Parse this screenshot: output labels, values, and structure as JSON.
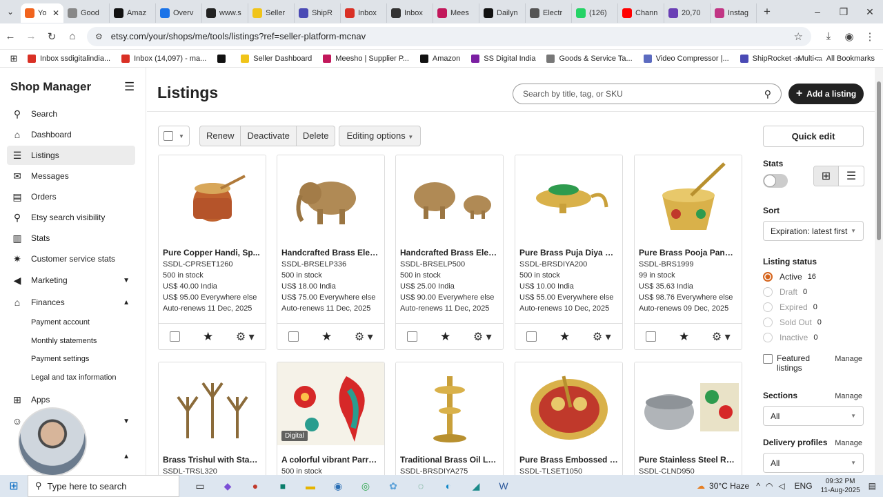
{
  "browser": {
    "tabs": [
      {
        "label": "Yo",
        "color": "#f1641e",
        "active": true
      },
      {
        "label": "Good",
        "color": "#888888"
      },
      {
        "label": "Amaz",
        "color": "#111111"
      },
      {
        "label": "Overv",
        "color": "#1a73e8"
      },
      {
        "label": "www.s",
        "color": "#222222"
      },
      {
        "label": "Seller",
        "color": "#f0c419"
      },
      {
        "label": "ShipR",
        "color": "#4a4ab5"
      },
      {
        "label": "Inbox",
        "color": "#d93025"
      },
      {
        "label": "Inbox",
        "color": "#333333"
      },
      {
        "label": "Mees",
        "color": "#c2185b"
      },
      {
        "label": "Dailyn",
        "color": "#111111"
      },
      {
        "label": "Electr",
        "color": "#555555"
      },
      {
        "label": "(126)",
        "color": "#25d366"
      },
      {
        "label": "Chann",
        "color": "#ff0000"
      },
      {
        "label": "20,70",
        "color": "#6a3fb5"
      },
      {
        "label": "Instag",
        "color": "#c13584"
      }
    ],
    "url": "etsy.com/your/shops/me/tools/listings?ref=seller-platform-mcnav",
    "bookmarks": [
      {
        "label": "Inbox ssdigitalindia...",
        "color": "#d93025"
      },
      {
        "label": "Inbox (14,097) - ma...",
        "color": "#d93025"
      },
      {
        "label": "",
        "color": "#111111"
      },
      {
        "label": "Seller Dashboard",
        "color": "#f0c419"
      },
      {
        "label": "Meesho | Supplier P...",
        "color": "#c2185b"
      },
      {
        "label": "Amazon",
        "color": "#111111"
      },
      {
        "label": "SS Digital India",
        "color": "#7b1fa2"
      },
      {
        "label": "Goods & Service Ta...",
        "color": "#777777"
      },
      {
        "label": "Video Compressor |...",
        "color": "#5c6bc0"
      },
      {
        "label": "ShipRocket - Multi-...",
        "color": "#4a4ab5"
      }
    ],
    "all_bookmarks": "All Bookmarks"
  },
  "sidebar": {
    "title": "Shop Manager",
    "items": [
      {
        "label": "Search",
        "icon": "search-icon",
        "glyph": "⚲"
      },
      {
        "label": "Dashboard",
        "icon": "home-icon",
        "glyph": "⌂"
      },
      {
        "label": "Listings",
        "icon": "listings-icon",
        "glyph": "☰"
      },
      {
        "label": "Messages",
        "icon": "messages-icon",
        "glyph": "✉"
      },
      {
        "label": "Orders",
        "icon": "orders-icon",
        "glyph": "▤"
      },
      {
        "label": "Etsy search visibility",
        "icon": "search-visibility-icon",
        "glyph": "⚲"
      },
      {
        "label": "Stats",
        "icon": "stats-icon",
        "glyph": "▥"
      },
      {
        "label": "Customer service stats",
        "icon": "customer-service-icon",
        "glyph": "✷"
      },
      {
        "label": "Marketing",
        "icon": "marketing-icon",
        "glyph": "◀"
      },
      {
        "label": "Finances",
        "icon": "finances-icon",
        "glyph": "⌂"
      },
      {
        "label": "Apps",
        "icon": "apps-icon",
        "glyph": "⊞"
      },
      {
        "label": "",
        "icon": "community-icon",
        "glyph": "☺"
      },
      {
        "label": "ena",
        "icon": "",
        "glyph": ""
      }
    ],
    "finance_sub": [
      "Payment account",
      "Monthly statements",
      "Payment settings",
      "Legal and tax information"
    ]
  },
  "main": {
    "title": "Listings",
    "search_placeholder": "Search by title, tag, or SKU",
    "add_button": "Add a listing",
    "bulk_buttons": [
      "Renew",
      "Deactivate",
      "Delete"
    ],
    "editing_options": "Editing options"
  },
  "listings": [
    {
      "title": "Pure Copper Handi, Sp...",
      "sku": "SSDL-CPRSET1260",
      "stock": "500 in stock",
      "price_india": "US$ 40.00 India",
      "price_else": "US$ 95.00 Everywhere else",
      "renews": "Auto-renews 11 Dec, 2025"
    },
    {
      "title": "Handcrafted Brass Elep...",
      "sku": "SSDL-BRSELP336",
      "stock": "500 in stock",
      "price_india": "US$ 18.00 India",
      "price_else": "US$ 75.00 Everywhere else",
      "renews": "Auto-renews 11 Dec, 2025"
    },
    {
      "title": "Handcrafted Brass Elep...",
      "sku": "SSDL-BRSELP500",
      "stock": "500 in stock",
      "price_india": "US$ 25.00 India",
      "price_else": "US$ 90.00 Everywhere else",
      "renews": "Auto-renews 11 Dec, 2025"
    },
    {
      "title": "Pure Brass Puja Diya wit...",
      "sku": "SSDL-BRSDIYA200",
      "stock": "500 in stock",
      "price_india": "US$ 10.00 India",
      "price_else": "US$ 55.00 Everywhere else",
      "renews": "Auto-renews 10 Dec, 2025"
    },
    {
      "title": "Pure Brass Pooja Panch ...",
      "sku": "SSDL-BRS1999",
      "stock": "99 in stock",
      "price_india": "US$ 35.63 India",
      "price_else": "US$ 98.76 Everywhere else",
      "renews": "Auto-renews 09 Dec, 2025"
    },
    {
      "title": "Brass Trishul with Stand...",
      "sku": "SSDL-TRSL320",
      "stock": "",
      "price_india": "",
      "price_else": "",
      "renews": ""
    },
    {
      "title": "A colorful vibrant Parrot...",
      "sku": "500 in stock",
      "stock": "",
      "price_india": "",
      "price_else": "",
      "renews": "",
      "badge": "Digital"
    },
    {
      "title": "Traditional Brass Oil La...",
      "sku": "SSDL-BRSDIYA275",
      "stock": "",
      "price_india": "",
      "price_else": "",
      "renews": ""
    },
    {
      "title": "Pure Brass Embossed D...",
      "sku": "SSDL-TLSET1050",
      "stock": "",
      "price_india": "",
      "price_else": "",
      "renews": ""
    },
    {
      "title": "Pure Stainless Steel Ro...",
      "sku": "SSDL-CLND950",
      "stock": "",
      "price_india": "",
      "price_else": "",
      "renews": ""
    }
  ],
  "right_panel": {
    "quick_edit": "Quick edit",
    "stats_label": "Stats",
    "sort_label": "Sort",
    "sort_value": "Expiration: latest first",
    "status_label": "Listing status",
    "statuses": [
      {
        "label": "Active",
        "count": "16",
        "active": true
      },
      {
        "label": "Draft",
        "count": "0"
      },
      {
        "label": "Expired",
        "count": "0"
      },
      {
        "label": "Sold Out",
        "count": "0"
      },
      {
        "label": "Inactive",
        "count": "0"
      }
    ],
    "featured_label": "Featured listings",
    "manage": "Manage",
    "sections_label": "Sections",
    "sections_value": "All",
    "delivery_label": "Delivery profiles",
    "delivery_value": "All"
  },
  "taskbar": {
    "search_placeholder": "Type here to search",
    "weather": "30°C Haze",
    "lang": "ENG",
    "time": "09:32 PM",
    "date": "11-Aug-2025"
  }
}
